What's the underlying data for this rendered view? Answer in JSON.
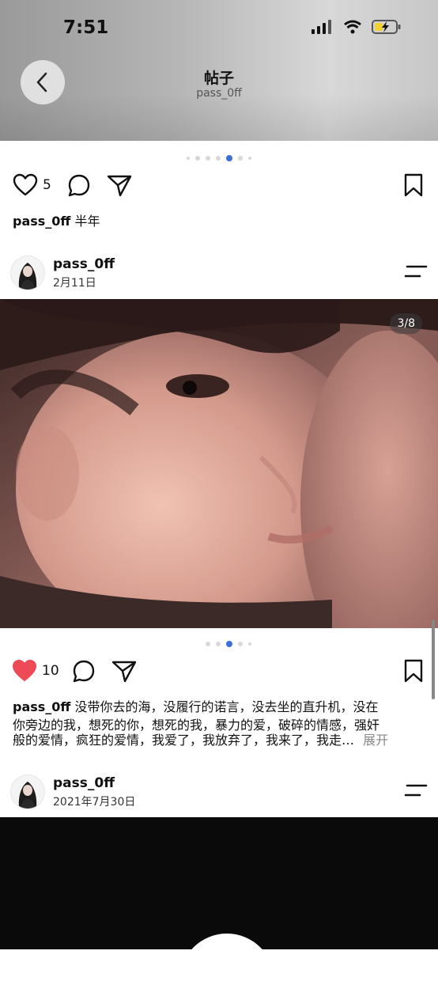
{
  "status_bar": {
    "time": "7:51"
  },
  "header": {
    "title": "帖子",
    "subtitle": "pass_0ff"
  },
  "post1": {
    "likes": "5",
    "caption_user": "pass_0ff",
    "caption_text": "半年"
  },
  "post2": {
    "username": "pass_0ff",
    "date": "2月11日",
    "photo_counter": "3/8",
    "likes": "10",
    "caption_user": "pass_0ff",
    "caption_line1": "没带你去的海，没履行的诺言，没去坐的直升机，没在",
    "caption_line2": "你旁边的我，想死的你，想死的我，暴力的爱，破碎的情感，强奸",
    "caption_line3": "般的爱情，疯狂的爱情，我爱了，我放弃了，我来了，我走…",
    "expand_label": "展开"
  },
  "post3": {
    "username": "pass_0ff",
    "date": "2021年7月30日"
  },
  "colors": {
    "like_red": "#ed4956",
    "accent_blue": "#3b6fd8"
  }
}
